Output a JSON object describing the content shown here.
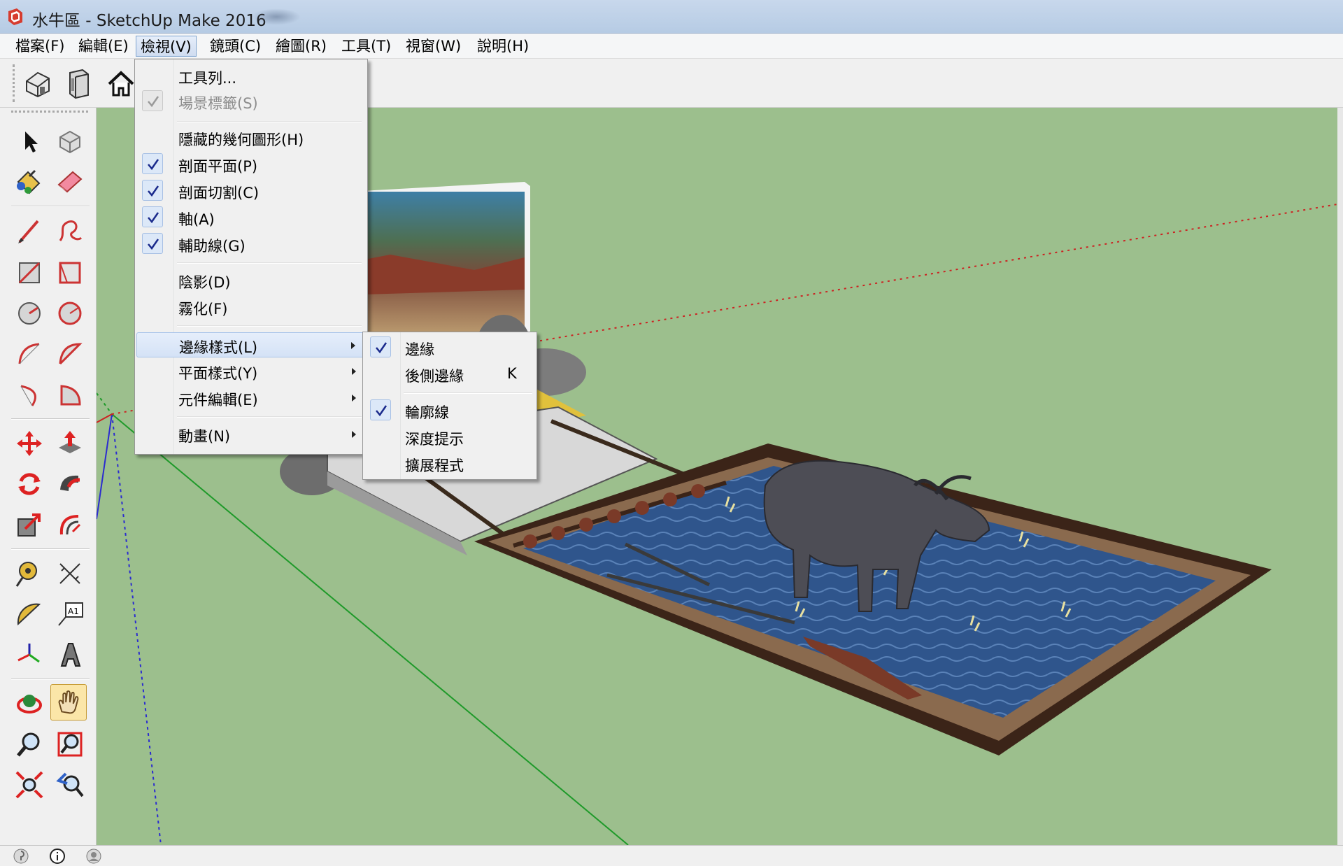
{
  "window": {
    "title": "水牛區 - SketchUp Make 2016",
    "app_icon": "sketchup-logo-icon"
  },
  "menubar": {
    "items": [
      {
        "label": "檔案(F)"
      },
      {
        "label": "編輯(E)"
      },
      {
        "label": "檢視(V)",
        "active": true
      },
      {
        "label": "鏡頭(C)"
      },
      {
        "label": "繪圖(R)"
      },
      {
        "label": "工具(T)"
      },
      {
        "label": "視窗(W)"
      },
      {
        "label": "說明(H)"
      }
    ]
  },
  "top_toolbar": {
    "icons": [
      "iso-view-icon",
      "front-view-icon",
      "home-icon"
    ]
  },
  "left_toolbar": {
    "tools": [
      "select-icon",
      "make-component-icon",
      "paint-bucket-icon",
      "eraser-icon",
      "pencil-line-icon",
      "freehand-icon",
      "rectangle-icon",
      "rotated-rectangle-icon",
      "circle-icon",
      "polygon-icon",
      "arc-icon",
      "two-point-arc-icon",
      "three-point-arc-icon",
      "pie-icon",
      "move-icon",
      "push-pull-icon",
      "rotate-icon",
      "follow-me-icon",
      "scale-icon",
      "offset-icon",
      "tape-measure-icon",
      "dimension-icon",
      "protractor-icon",
      "text-icon",
      "axes-icon",
      "3d-text-icon",
      "orbit-icon",
      "pan-icon",
      "zoom-icon",
      "zoom-window-icon",
      "zoom-extents-icon",
      "previous-view-icon"
    ],
    "pressed": "pan-icon"
  },
  "view_menu": {
    "items": [
      {
        "label": "工具列...",
        "checked": false,
        "disabled": false,
        "submenu": false
      },
      {
        "label": "場景標籤(S)",
        "checked": true,
        "disabled": true,
        "submenu": false
      },
      {
        "label": "隱藏的幾何圖形(H)",
        "checked": false,
        "disabled": false,
        "submenu": false
      },
      {
        "label": "剖面平面(P)",
        "checked": true,
        "disabled": false,
        "submenu": false
      },
      {
        "label": "剖面切割(C)",
        "checked": true,
        "disabled": false,
        "submenu": false
      },
      {
        "label": "軸(A)",
        "checked": true,
        "disabled": false,
        "submenu": false
      },
      {
        "label": "輔助線(G)",
        "checked": true,
        "disabled": false,
        "submenu": false
      },
      {
        "label": "陰影(D)",
        "checked": false,
        "disabled": false,
        "submenu": false
      },
      {
        "label": "霧化(F)",
        "checked": false,
        "disabled": false,
        "submenu": false
      },
      {
        "label": "邊緣樣式(L)",
        "checked": false,
        "disabled": false,
        "submenu": true,
        "highlighted": true
      },
      {
        "label": "平面樣式(Y)",
        "checked": false,
        "disabled": false,
        "submenu": true
      },
      {
        "label": "元件編輯(E)",
        "checked": false,
        "disabled": false,
        "submenu": true
      },
      {
        "label": "動畫(N)",
        "checked": false,
        "disabled": false,
        "submenu": true
      }
    ]
  },
  "edge_style_submenu": {
    "items": [
      {
        "label": "邊緣",
        "checked": true,
        "shortcut": ""
      },
      {
        "label": "後側邊緣",
        "checked": false,
        "shortcut": "K"
      },
      {
        "label": "輪廓線",
        "checked": true,
        "shortcut": ""
      },
      {
        "label": "深度提示",
        "checked": false,
        "shortcut": ""
      },
      {
        "label": "擴展程式",
        "checked": false,
        "shortcut": ""
      }
    ]
  },
  "statusbar": {
    "icons": [
      "geo-location-icon",
      "info-icon",
      "user-icon"
    ]
  },
  "colors": {
    "viewport_bg": "#9cbf8d",
    "water": "#2f558c",
    "fence": "#3b2418",
    "axis_red": "#cc2222",
    "axis_green": "#1f9a2a",
    "axis_blue": "#2b2bd0"
  }
}
